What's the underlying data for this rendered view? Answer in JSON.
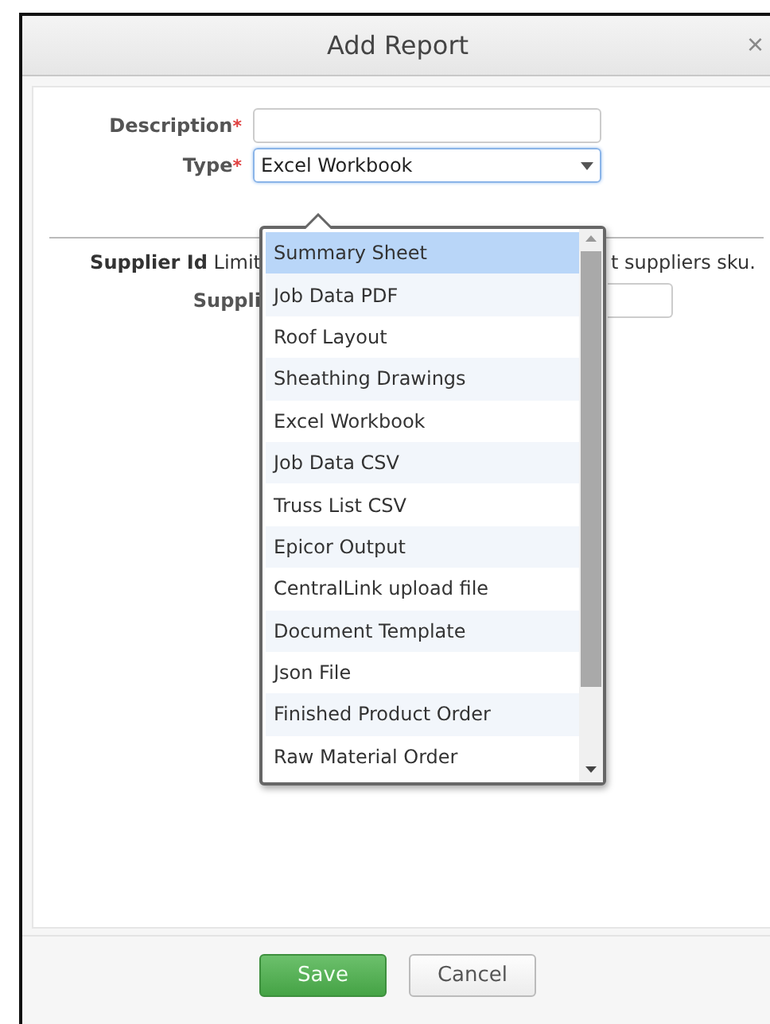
{
  "dialog": {
    "title": "Add Report",
    "close": "×"
  },
  "fields": [
    {
      "label": "Description",
      "required_mark": "*",
      "kind": "text"
    },
    {
      "label": "Type",
      "required_mark": "*",
      "kind": "select",
      "value": "Excel Workbook"
    }
  ],
  "supplier": {
    "note_start": "**Supplier Id** Limit",
    "note_end": "t suppliers sku.",
    "field_label": "Suppli"
  },
  "dropdown": {
    "items": [
      {
        "label": "Summary Sheet",
        "selected": true
      },
      {
        "label": "Job Data PDF",
        "selected": false
      },
      {
        "label": "Roof Layout",
        "selected": false
      },
      {
        "label": "Sheathing Drawings",
        "selected": false
      },
      {
        "label": "Excel Workbook",
        "selected": false
      },
      {
        "label": "Job Data CSV",
        "selected": false
      },
      {
        "label": "Truss List CSV",
        "selected": false
      },
      {
        "label": "Epicor Output",
        "selected": false
      },
      {
        "label": "CentralLink upload file",
        "selected": false
      },
      {
        "label": "Document Template",
        "selected": false
      },
      {
        "label": "Json File",
        "selected": false
      },
      {
        "label": "Finished Product Order",
        "selected": false
      },
      {
        "label": "Raw Material Order",
        "selected": false
      }
    ]
  },
  "buttons": [
    {
      "label": "Save",
      "kind": "primary"
    },
    {
      "label": "Cancel",
      "kind": "secondary"
    }
  ]
}
